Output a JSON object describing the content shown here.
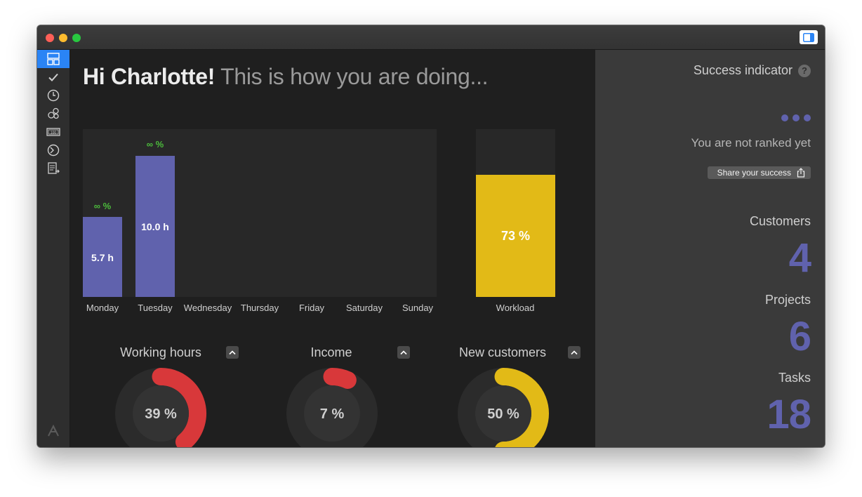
{
  "greeting": {
    "name_part": "Hi Charlotte!",
    "rest": "This is how you are doing..."
  },
  "week_chart": {
    "days": [
      "Monday",
      "Tuesday",
      "Wednesday",
      "Thursday",
      "Friday",
      "Saturday",
      "Sunday"
    ],
    "bars": [
      {
        "day": "Monday",
        "value_label": "5.7 h",
        "pct_label": "∞ %"
      },
      {
        "day": "Tuesday",
        "value_label": "10.0 h",
        "pct_label": "∞ %"
      }
    ]
  },
  "chart_data": {
    "type": "bar",
    "categories": [
      "Monday",
      "Tuesday",
      "Wednesday",
      "Thursday",
      "Friday",
      "Saturday",
      "Sunday"
    ],
    "values": [
      5.7,
      10.0,
      null,
      null,
      null,
      null,
      null
    ]
  },
  "workload": {
    "label": "Workload",
    "percent_label": "73 %",
    "percent": 73,
    "color": "#e2ba17"
  },
  "gauges": [
    {
      "title": "Working hours",
      "value_label": "39 %",
      "percent": 39,
      "color": "#d8383a"
    },
    {
      "title": "Income",
      "value_label": "7 %",
      "percent": 7,
      "color": "#d8383a"
    },
    {
      "title": "New customers",
      "value_label": "50 %",
      "percent": 50,
      "color": "#e2ba17"
    }
  ],
  "success": {
    "title": "Success indicator",
    "help": "?",
    "rank_text": "You are not ranked yet",
    "share_label": "Share your success"
  },
  "stats": [
    {
      "label": "Customers",
      "value": "4"
    },
    {
      "label": "Projects",
      "value": "6"
    },
    {
      "label": "Tasks",
      "value": "18"
    }
  ],
  "nav": [
    {
      "icon": "dashboard-icon"
    },
    {
      "icon": "checkmark-icon"
    },
    {
      "icon": "clock-icon"
    },
    {
      "icon": "clients-icon"
    },
    {
      "icon": "banknote-icon"
    },
    {
      "icon": "finance-icon"
    },
    {
      "icon": "reports-icon"
    },
    {
      "icon": "app-logo-icon"
    }
  ]
}
